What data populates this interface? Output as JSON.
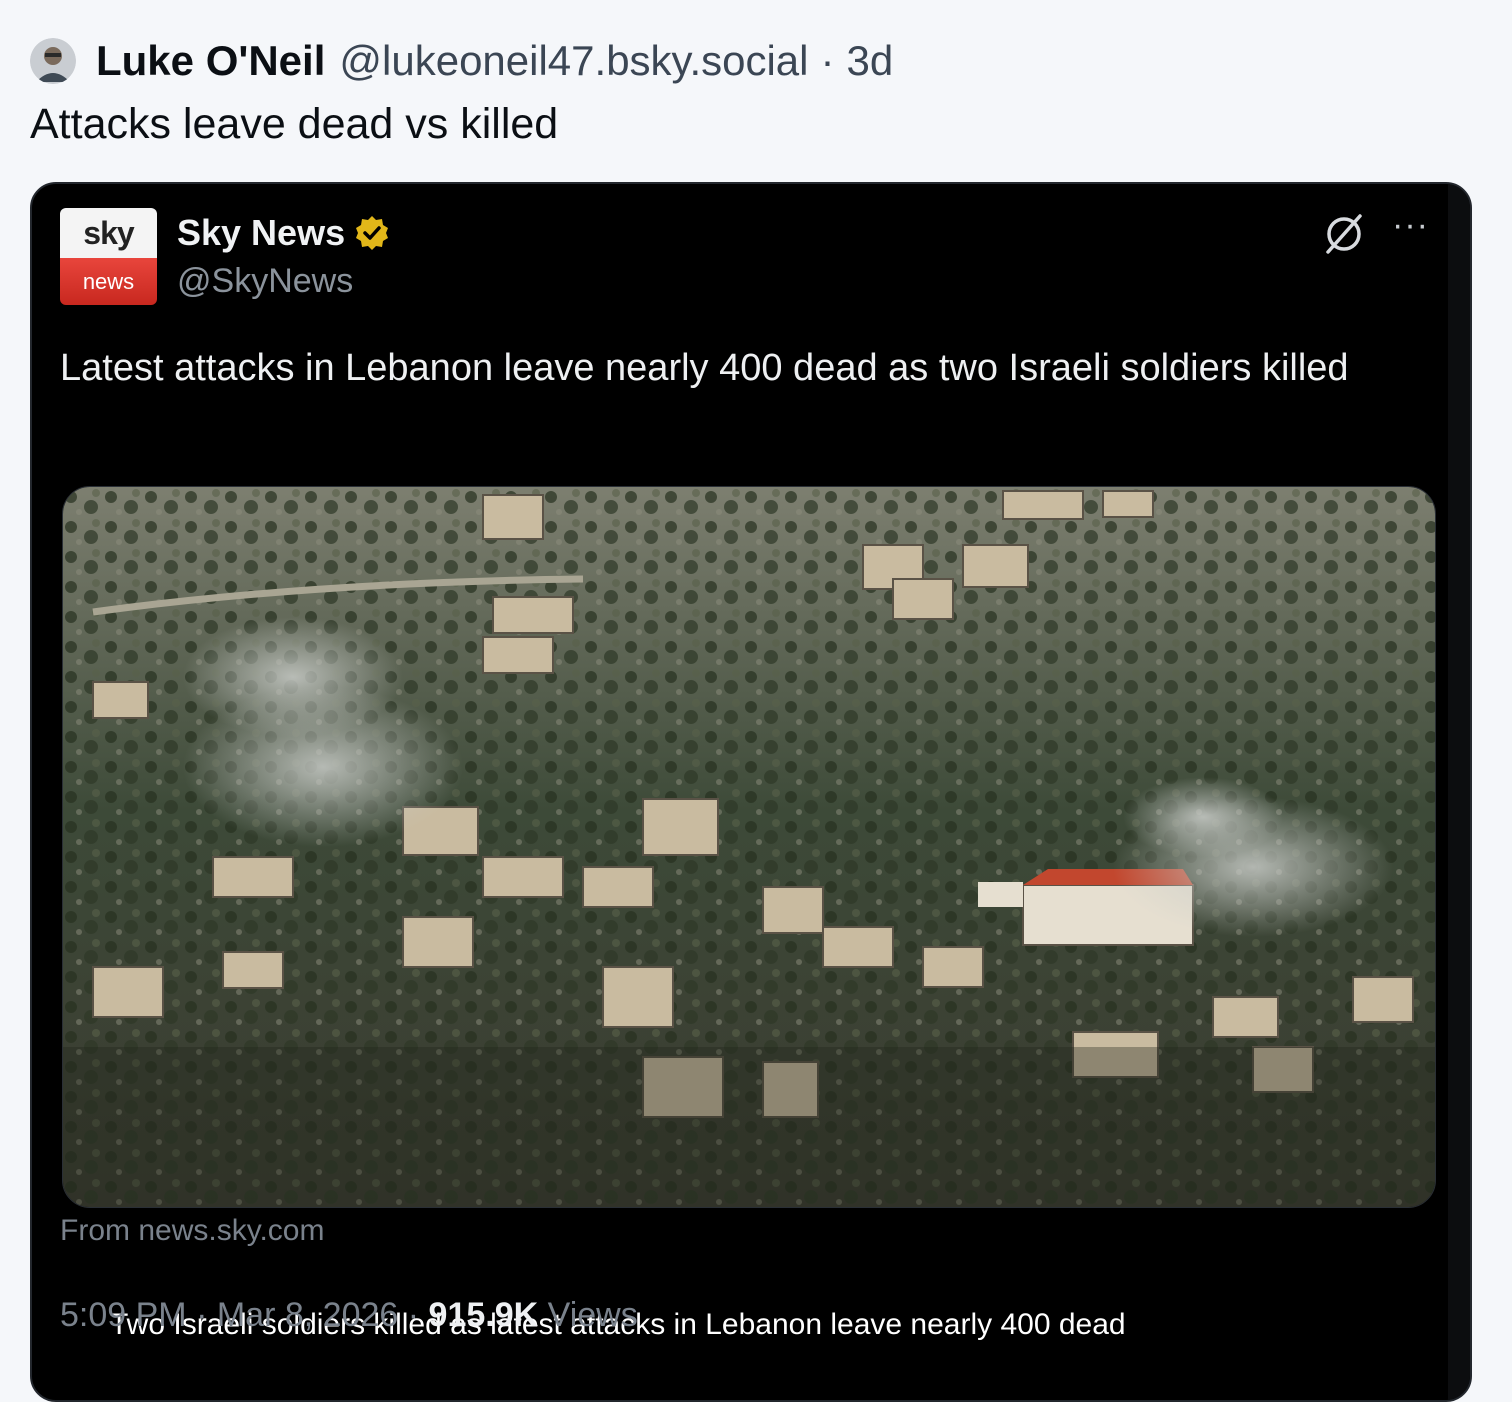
{
  "post": {
    "author_name": "Luke O'Neil",
    "author_handle": "@lukeoneil47.bsky.social",
    "separator": "·",
    "age": "3d",
    "text": "Attacks leave dead vs killed"
  },
  "embed": {
    "logo_top": "sky",
    "logo_bottom": "news",
    "account_name": "Sky News",
    "account_handle": "@SkyNews",
    "more_label": "···",
    "tweet_text": "Latest attacks in Lebanon leave nearly 400 dead as two Israeli soldiers killed",
    "media_caption": "Two Israeli soldiers killed as latest attacks in Lebanon leave nearly 400 dead",
    "source": "From news.sky.com",
    "time": "5:09 PM",
    "date": "Mar 8, 2026",
    "dot": "·",
    "views_count": "915.9K",
    "views_label": "Views"
  },
  "colors": {
    "page_bg": "#f5f7fa",
    "embed_bg": "#000000",
    "verified_badge": "#e2b719",
    "sky_red": "#d9362d"
  },
  "icons": {
    "verified": "verified-badge-icon",
    "x_logo": "x-brand-icon",
    "more": "more-options-icon"
  }
}
